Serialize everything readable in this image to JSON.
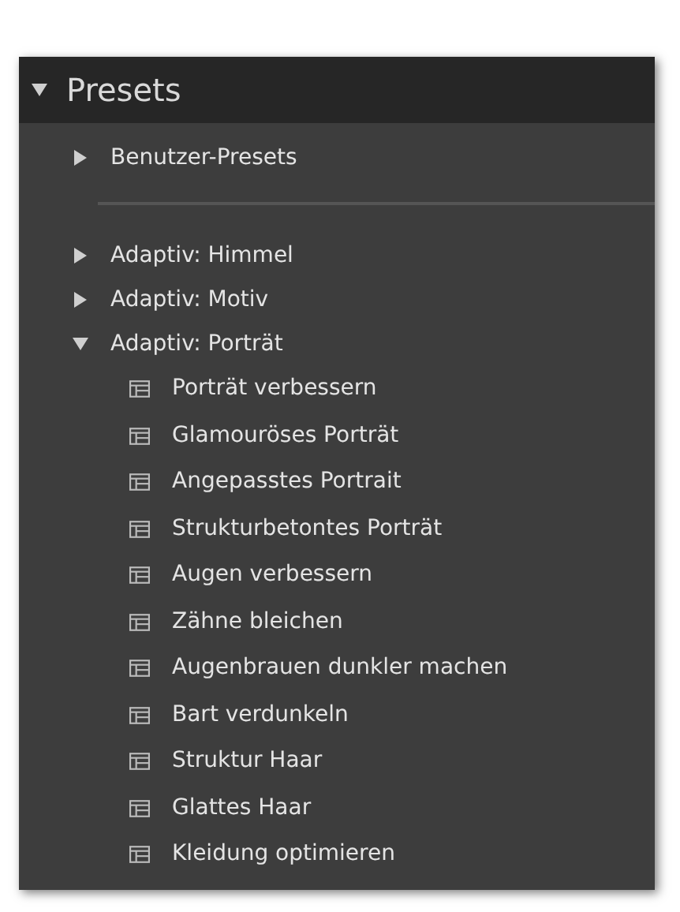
{
  "panel": {
    "title": "Presets",
    "expanded": true
  },
  "sections": [
    {
      "groups": [
        {
          "label": "Benutzer-Presets",
          "expanded": false
        }
      ]
    },
    {
      "groups": [
        {
          "label": "Adaptiv: Himmel",
          "expanded": false
        },
        {
          "label": "Adaptiv: Motiv",
          "expanded": false
        },
        {
          "label": "Adaptiv: Porträt",
          "expanded": true,
          "children": [
            {
              "label": "Porträt verbessern"
            },
            {
              "label": "Glamouröses Porträt"
            },
            {
              "label": "Angepasstes Portrait"
            },
            {
              "label": "Strukturbetontes Porträt"
            },
            {
              "label": "Augen verbessern"
            },
            {
              "label": "Zähne bleichen"
            },
            {
              "label": "Augenbrauen dunkler machen"
            },
            {
              "label": "Bart verdunkeln"
            },
            {
              "label": "Struktur Haar"
            },
            {
              "label": "Glattes Haar"
            },
            {
              "label": "Kleidung optimieren"
            }
          ]
        }
      ]
    }
  ]
}
